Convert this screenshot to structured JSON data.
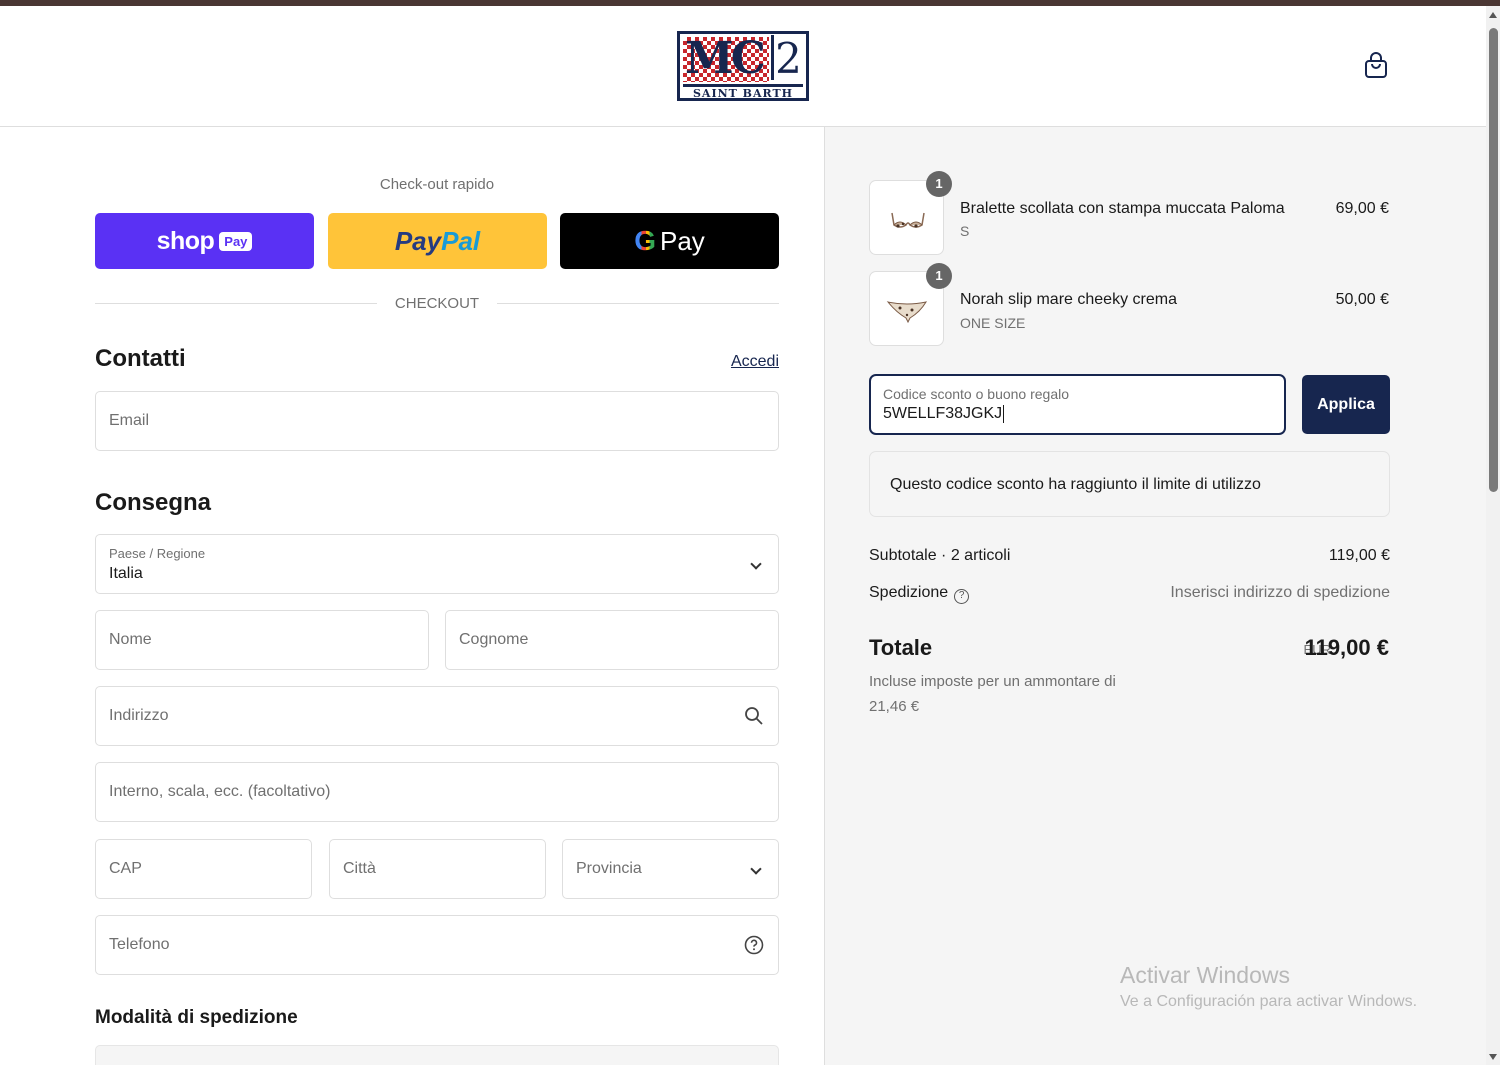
{
  "header": {
    "logo_main": "MC",
    "logo_two": "2",
    "logo_sub": "SAINT BARTH",
    "cart_icon": "shopping-bag-icon"
  },
  "express": {
    "label": "Check-out rapido",
    "shop_pay": {
      "word": "shop",
      "badge": "Pay"
    },
    "paypal": {
      "part1": "Pay",
      "part2": "Pal"
    },
    "gpay": {
      "g": "G",
      "word": "Pay"
    }
  },
  "divider_label": "CHECKOUT",
  "contact": {
    "title": "Contatti",
    "login_link": "Accedi",
    "email_placeholder": "Email"
  },
  "delivery": {
    "title": "Consegna",
    "country_label": "Paese / Regione",
    "country_value": "Italia",
    "first_name_placeholder": "Nome",
    "last_name_placeholder": "Cognome",
    "address_placeholder": "Indirizzo",
    "address2_placeholder": "Interno, scala, ecc. (facoltativo)",
    "zip_placeholder": "CAP",
    "city_placeholder": "Città",
    "province_placeholder": "Provincia",
    "phone_placeholder": "Telefono"
  },
  "shipping_method": {
    "title": "Modalità di spedizione"
  },
  "cart": {
    "items": [
      {
        "qty": "1",
        "name": "Bralette scollata con stampa muccata Paloma",
        "variant": "S",
        "price": "69,00 €"
      },
      {
        "qty": "1",
        "name": "Norah slip mare cheeky crema",
        "variant": "ONE SIZE",
        "price": "50,00 €"
      }
    ]
  },
  "discount": {
    "label": "Codice sconto o buono regalo",
    "value": "5WELLF38JGKJ",
    "apply_label": "Applica",
    "error": "Questo codice sconto ha raggiunto il limite di utilizzo"
  },
  "summary": {
    "subtotal_label": "Subtotale · 2 articoli",
    "subtotal_value": "119,00 €",
    "shipping_label": "Spedizione",
    "shipping_value": "Inserisci indirizzo di spedizione",
    "total_label": "Totale",
    "total_currency": "EUR",
    "total_value": "119,00 €",
    "tax_note": "Incluse imposte per un ammontare di 21,46 €"
  },
  "watermark": {
    "title": "Activar Windows",
    "subtitle": "Ve a Configuración para activar Windows."
  },
  "colors": {
    "brand_navy": "#17264f",
    "shop_pay": "#5a31f4",
    "paypal": "#ffc439",
    "gpay": "#000000",
    "top_bar": "#4a3633"
  }
}
